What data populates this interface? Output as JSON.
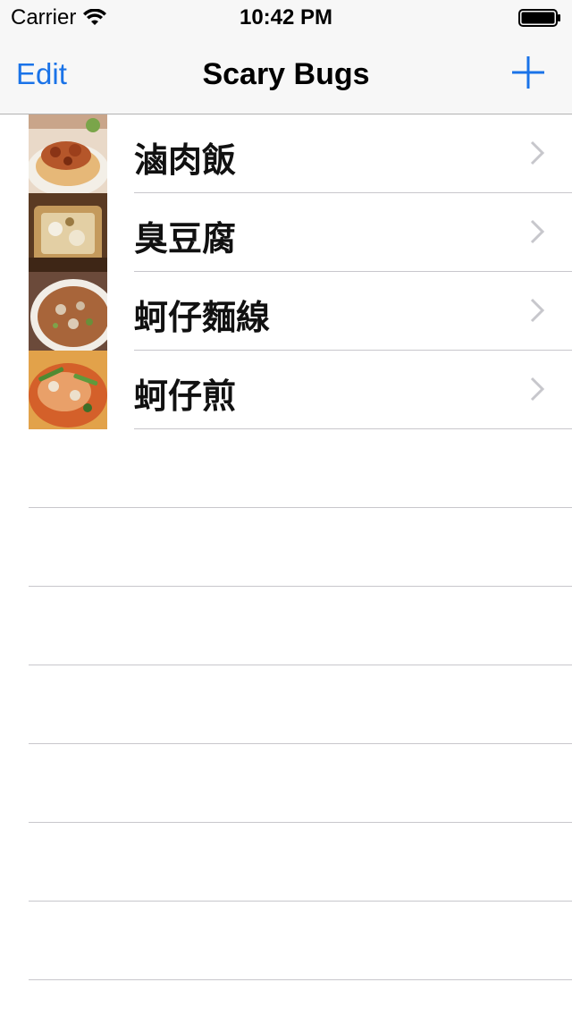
{
  "status_bar": {
    "carrier": "Carrier",
    "time": "10:42 PM"
  },
  "nav_bar": {
    "edit_label": "Edit",
    "title": "Scary Bugs",
    "add_icon": "plus-icon",
    "accent_color": "#1a73e8"
  },
  "rows": [
    {
      "label": "滷肉飯",
      "thumbnail": "braised-pork-rice"
    },
    {
      "label": "臭豆腐",
      "thumbnail": "stinky-tofu"
    },
    {
      "label": "蚵仔麵線",
      "thumbnail": "oyster-vermicelli"
    },
    {
      "label": "蚵仔煎",
      "thumbnail": "oyster-omelette"
    }
  ]
}
